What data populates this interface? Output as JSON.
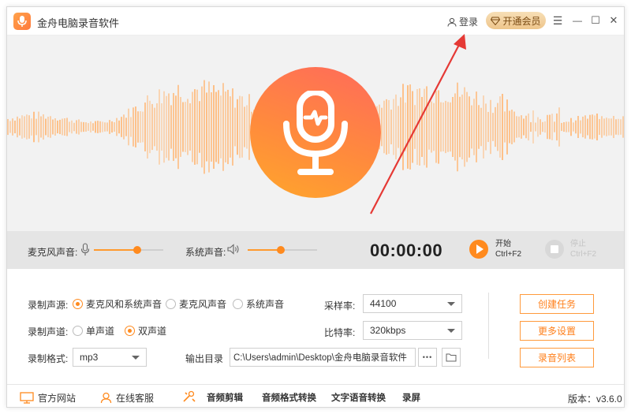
{
  "titlebar": {
    "app_title": "金舟电脑录音软件",
    "login_label": "登录",
    "vip_label": "开通会员",
    "menu_glyph": "☰",
    "min_glyph": "—",
    "max_glyph": "☐",
    "close_glyph": "✕"
  },
  "controls": {
    "mic_volume_label": "麦克风声音:",
    "mic_volume_fraction": 0.62,
    "system_volume_label": "系统声音:",
    "system_volume_fraction": 0.48,
    "timer": "00:00:00",
    "start_label": "开始",
    "start_shortcut": "Ctrl+F2",
    "stop_label": "停止",
    "stop_shortcut": "Ctrl+F2"
  },
  "settings": {
    "source_label": "录制声源:",
    "source_options": [
      "麦克风和系统声音",
      "麦克风声音",
      "系统声音"
    ],
    "source_selected": 0,
    "channel_label": "录制声道:",
    "channel_options": [
      "单声道",
      "双声道"
    ],
    "channel_selected": 1,
    "format_label": "录制格式:",
    "format_value": "mp3",
    "output_label": "输出目录",
    "output_path": "C:\\Users\\admin\\Desktop\\金舟电脑录音软件",
    "more_glyph": "•••",
    "sample_rate_label": "采样率:",
    "sample_rate_value": "44100",
    "bitrate_label": "比特率:",
    "bitrate_value": "320kbps",
    "create_task_label": "创建任务",
    "more_settings_label": "更多设置",
    "recording_list_label": "录音列表"
  },
  "footer": {
    "website_label": "官方网站",
    "support_label": "在线客服",
    "tools": [
      "音频剪辑",
      "音频格式转换",
      "文字语音转换",
      "录屏"
    ],
    "version": "版本：v3.6.0"
  },
  "colors": {
    "accent": "#ff8a1e",
    "wave": "#ffb877"
  }
}
